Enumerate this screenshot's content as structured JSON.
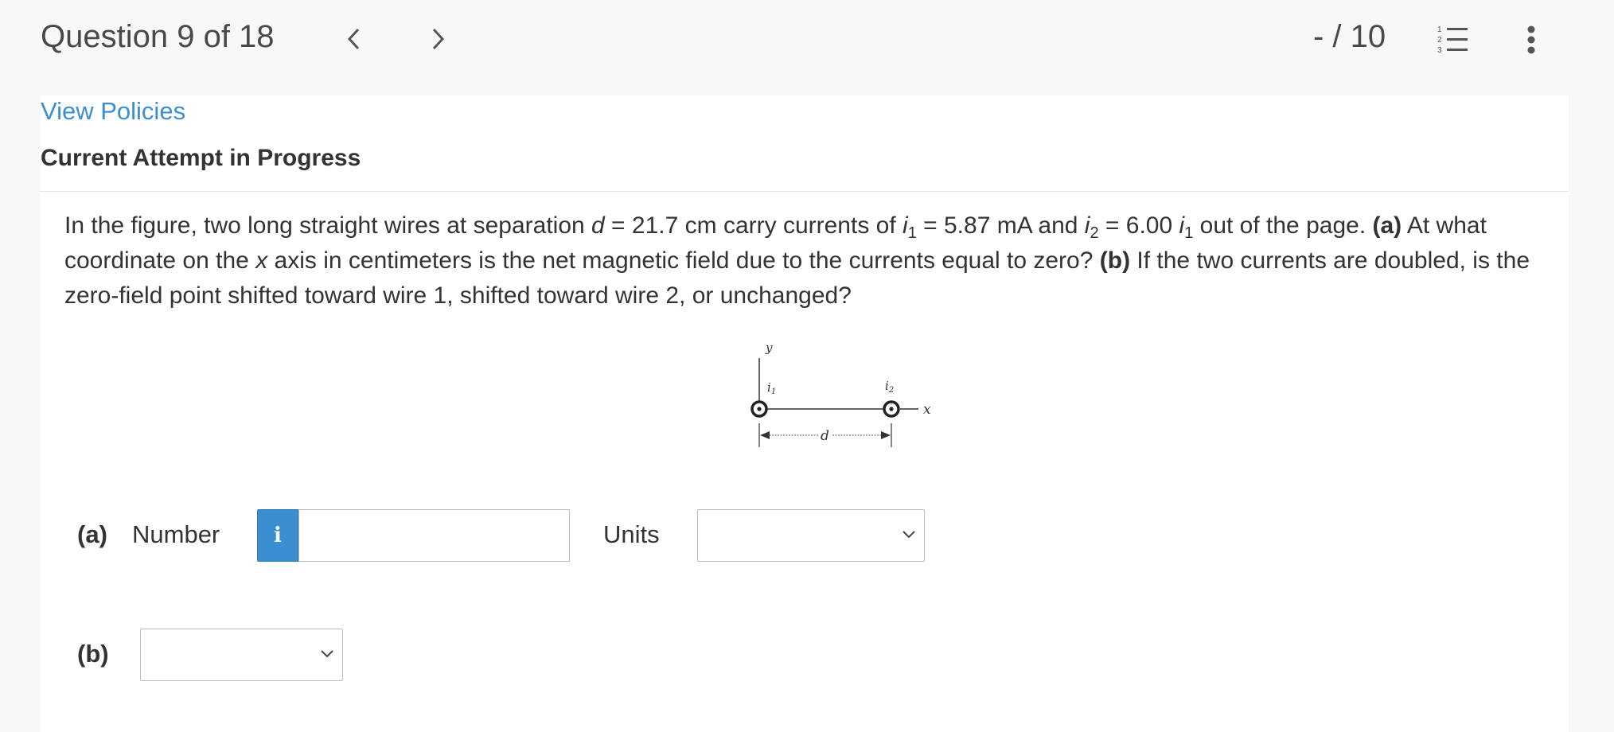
{
  "header": {
    "question_counter": "Question 9 of 18",
    "score": "- / 10",
    "prev_icon": "chevron-left-icon",
    "next_icon": "chevron-right-icon",
    "list_icon": "numbered-list-icon",
    "list_icon_digits": [
      "1",
      "2",
      "3"
    ],
    "menu_icon": "kebab-menu-icon"
  },
  "links": {
    "view_policies": "View Policies"
  },
  "attempt_heading": "Current Attempt in Progress",
  "question": {
    "p1": "In the figure, two long straight wires at separation ",
    "v_d": "d",
    "p2": " = 21.7 cm carry currents of ",
    "v_i1": "i",
    "s1": "1",
    "p3": " = 5.87 mA and ",
    "v_i2": "i",
    "s2": "2",
    "p4": " = 6.00 ",
    "v_i3": "i",
    "s3": "1",
    "p5": " out of the page. ",
    "a_label": "(a)",
    "p6": " At what coordinate on the ",
    "v_x": "x",
    "p7": " axis in centimeters is the net magnetic field due to the currents equal to zero? ",
    "b_label": "(b)",
    "p8": " If the two currents are doubled, is the zero-field point shifted toward wire 1, shifted toward wire 2, or unchanged?"
  },
  "figure": {
    "y_label": "y",
    "x_label": "x",
    "i1_label": "i",
    "i1_sub": "1",
    "i2_label": "i",
    "i2_sub": "2",
    "d_label": "d"
  },
  "part_a": {
    "label": "(a)",
    "number_label": "Number",
    "info_label": "i",
    "number_value": "",
    "units_label": "Units",
    "units_selected": ""
  },
  "part_b": {
    "label": "(b)",
    "selected": ""
  },
  "colors": {
    "link": "#3b8ed0",
    "info_button": "#3b8ed0",
    "background": "#f8f8f8",
    "panel": "#ffffff"
  }
}
